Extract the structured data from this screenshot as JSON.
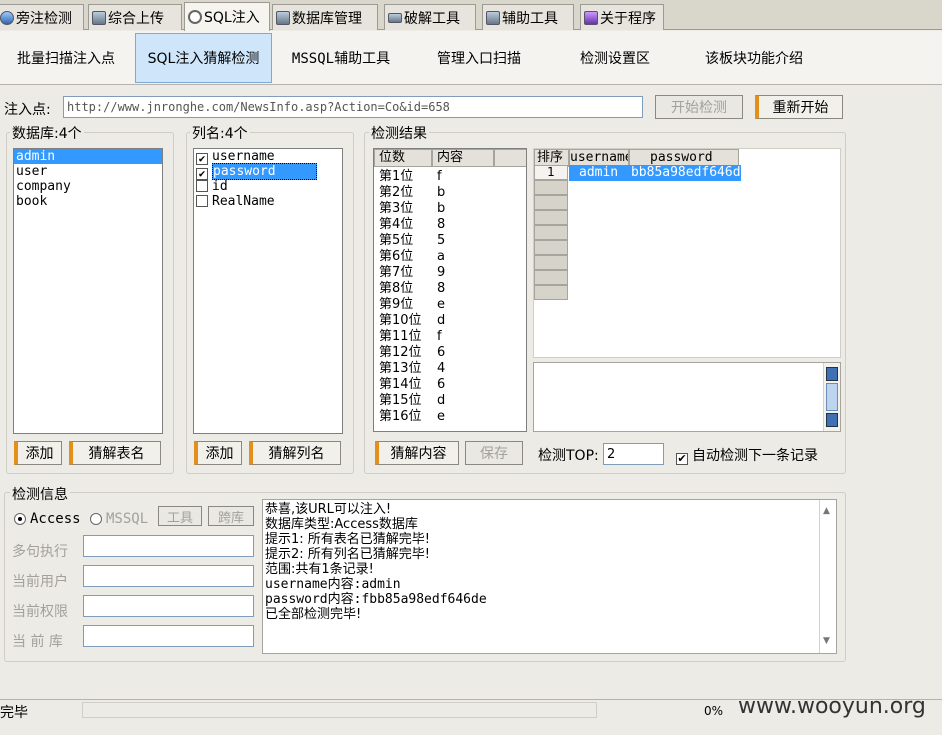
{
  "top_tabs": [
    {
      "label": "旁注检测",
      "icon": "globe-icon"
    },
    {
      "label": "综合上传",
      "icon": "upload-icon"
    },
    {
      "label": "SQL注入",
      "icon": "magnifier-icon"
    },
    {
      "label": "数据库管理",
      "icon": "database-icon"
    },
    {
      "label": "破解工具",
      "icon": "keyboard-icon"
    },
    {
      "label": "辅助工具",
      "icon": "tools-icon"
    },
    {
      "label": "关于程序",
      "icon": "info-icon"
    }
  ],
  "sub_tabs": [
    "批量扫描注入点",
    "SQL注入猜解检测",
    "MSSQL辅助工具",
    "管理入口扫描",
    "检测设置区",
    "该板块功能介绍"
  ],
  "inject": {
    "label": "注入点:",
    "url": "http://www.jnronghe.com/NewsInfo.asp?Action=Co&id=658",
    "start_button": "开始检测",
    "restart_button": "重新开始"
  },
  "database_panel": {
    "label": "数据库:4个",
    "items": [
      "admin",
      "user",
      "company",
      "book"
    ],
    "add_button": "添加",
    "guess_button": "猜解表名"
  },
  "column_panel": {
    "label": "列名:4个",
    "items": [
      {
        "name": "username",
        "checked": true
      },
      {
        "name": "password",
        "checked": true
      },
      {
        "name": "id",
        "checked": false
      },
      {
        "name": "RealName",
        "checked": false
      }
    ],
    "add_button": "添加",
    "guess_button": "猜解列名"
  },
  "result_panel": {
    "label": "检测结果",
    "digit_table": {
      "headers": [
        "位数",
        "内容"
      ],
      "rows": [
        [
          "第1位",
          "f"
        ],
        [
          "第2位",
          "b"
        ],
        [
          "第3位",
          "b"
        ],
        [
          "第4位",
          "8"
        ],
        [
          "第5位",
          "5"
        ],
        [
          "第6位",
          "a"
        ],
        [
          "第7位",
          "9"
        ],
        [
          "第8位",
          "8"
        ],
        [
          "第9位",
          "e"
        ],
        [
          "第10位",
          "d"
        ],
        [
          "第11位",
          "f"
        ],
        [
          "第12位",
          "6"
        ],
        [
          "第13位",
          "4"
        ],
        [
          "第14位",
          "6"
        ],
        [
          "第15位",
          "d"
        ],
        [
          "第16位",
          "e"
        ]
      ]
    },
    "record_table": {
      "headers": [
        "排序",
        "username",
        "password"
      ],
      "rows": [
        [
          "1",
          "admin",
          "bb85a98edf646d"
        ]
      ]
    },
    "guess_content_button": "猜解内容",
    "save_button": "保存",
    "top_label": "检测TOP:",
    "top_value": "2",
    "auto_label": "自动检测下一条记录",
    "auto_checked": true
  },
  "info_panel": {
    "label": "检测信息",
    "access_label": "Access",
    "mssql_label": "MSSQL",
    "tools_button": "工具",
    "cross_button": "跨库",
    "fields": [
      "多句执行",
      "当前用户",
      "当前权限",
      "当 前 库"
    ],
    "log": [
      "恭喜,该URL可以注入!",
      "数据库类型:Access数据库",
      "提示1: 所有表名已猜解完毕!",
      "提示2: 所有列名已猜解完毕!",
      "范围:共有1条记录!",
      "username内容:admin",
      "password内容:fbb85a98edf646de",
      "已全部检测完毕!"
    ]
  },
  "status": {
    "text": "完毕",
    "progress_text": "0%",
    "progress": 0,
    "watermark": "www.wooyun.org"
  }
}
